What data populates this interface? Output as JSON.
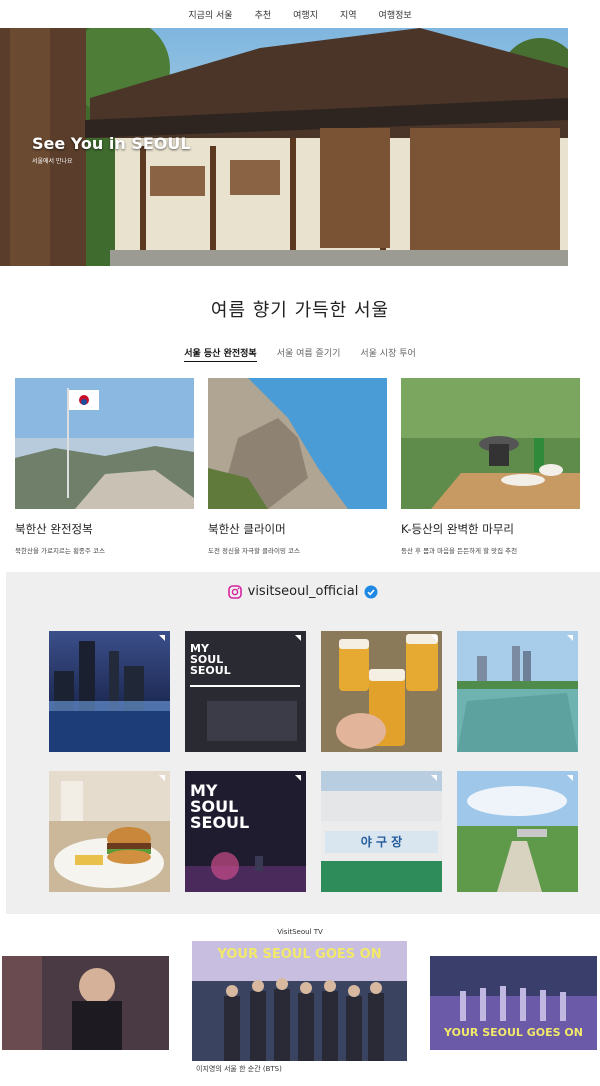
{
  "nav": {
    "items": [
      "지금의 서울",
      "추천",
      "여행지",
      "지역",
      "여행정보"
    ]
  },
  "hero": {
    "title": "See You in SEOUL",
    "subtitle": "서울에서 만나요",
    "slides": 4,
    "active_slide": 1
  },
  "section": {
    "title": "여름 향기 가득한 서울",
    "tabs": [
      "서울 등산 완전정복",
      "서울 여름 즐기기",
      "서울 시장 투어"
    ],
    "active_tab": 0,
    "cards": [
      {
        "title": "북한산 완전정복",
        "desc": "북한산을 가로지르는 횡종주 코스"
      },
      {
        "title": "북한산 클라이머",
        "desc": "도전 정신을 자극할 클라이밍 코스"
      },
      {
        "title": "K-등산의 완벽한 마무리",
        "desc": "등산 후 몸과 마음을 든든하게 할 맛집 추천"
      }
    ]
  },
  "instagram": {
    "handle": "visitseoul_official",
    "tiles": [
      {
        "text": ""
      },
      {
        "text": "MY SOUL SEOUL"
      },
      {
        "text": ""
      },
      {
        "text": ""
      },
      {
        "text": ""
      },
      {
        "text": "MY SOUL SEOUL"
      },
      {
        "text": "야 구 장"
      },
      {
        "text": ""
      }
    ]
  },
  "tv": {
    "label": "VisitSeoul TV",
    "videos": [
      {
        "overlay": "",
        "caption": ""
      },
      {
        "overlay": "YOUR SEOUL GOES ON",
        "caption": "이지영의 서울 한 순간 (BTS)"
      },
      {
        "overlay": "YOUR SEOUL GOES ON",
        "caption": ""
      }
    ]
  },
  "colors": {
    "accent": "#1e88e5",
    "insta_bg": "#efefef"
  }
}
